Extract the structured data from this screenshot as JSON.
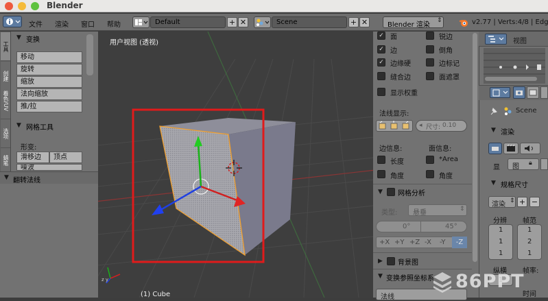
{
  "window": {
    "title": "Blender"
  },
  "menubar": {
    "menus": [
      "文件",
      "渲染",
      "窗口",
      "帮助"
    ],
    "layout_field": "Default",
    "scene_field": "Scene",
    "engine": "Blender 渲染",
    "status": "v2.77 | Verts:4/8 | Edges"
  },
  "toolshelf": {
    "tabs": [
      "工具",
      "创建",
      "着色/UV",
      "选项",
      "蜡笔"
    ],
    "transform_header": "变换",
    "transform_buttons": [
      "移动",
      "旋转",
      "缩放",
      "法向缩放",
      "推/拉"
    ],
    "mesh_tools_header": "网格工具",
    "deform_label": "形变:",
    "deform_buttons": [
      "滑移边",
      "顶点",
      "噪波"
    ],
    "flip_normals_header": "翻转法线"
  },
  "viewport": {
    "view_label": "用户视图 (透视)",
    "object_label": "(1) Cube"
  },
  "npanel": {
    "overlay_items_col1": [
      "面",
      "边",
      "边缘硬",
      "缝合边"
    ],
    "overlay_items_col2": [
      "锐边",
      "倒角",
      "边标记",
      "面遮罩"
    ],
    "overlay_checked_col1": [
      true,
      true,
      true,
      false
    ],
    "overlay_checked_col2": [
      false,
      false,
      false,
      false
    ],
    "show_weight": "显示权重",
    "normals_label": "法线显示:",
    "normal_size_label": "尺寸:",
    "normal_size_value": "0.10",
    "edge_info_label": "边信息:",
    "face_info_label": "面信息:",
    "edge_info_items": [
      "长度",
      "角度"
    ],
    "face_info_items": [
      "*Area",
      "角度"
    ],
    "mesh_analysis_header": "网格分析",
    "type_label": "类型:",
    "type_value": "悬垂",
    "angle_min": "0°",
    "angle_max": "45°",
    "axis_buttons": [
      "+X",
      "+Y",
      "+Z",
      "-X",
      "-Y",
      "-Z"
    ],
    "axis_active": "-Z",
    "background_header": "背景图",
    "transform_orient_header": "变换参照坐标系",
    "orient_value": "法线"
  },
  "outliner": {
    "view_menu": "视图",
    "scene_label": "Scene",
    "render_header": "渲染",
    "display_label": "显",
    "display_value": "图",
    "dimensions_header": "规格尺寸",
    "render_preset": "渲染",
    "resolution_label": "分辨",
    "framerate_label": "帧范",
    "res_values": [
      "1",
      "1",
      "1"
    ],
    "frame_values": [
      "1",
      "2",
      "1"
    ],
    "aspect_label": "纵横",
    "fps_label": "帧率:",
    "aspect_value": "1",
    "time_label": "时间"
  },
  "watermark": "86PPT",
  "colors": {
    "selection_box": "#e01b1b",
    "face_orange": "#f0a030",
    "accent_blue": "#5d7ba0"
  }
}
